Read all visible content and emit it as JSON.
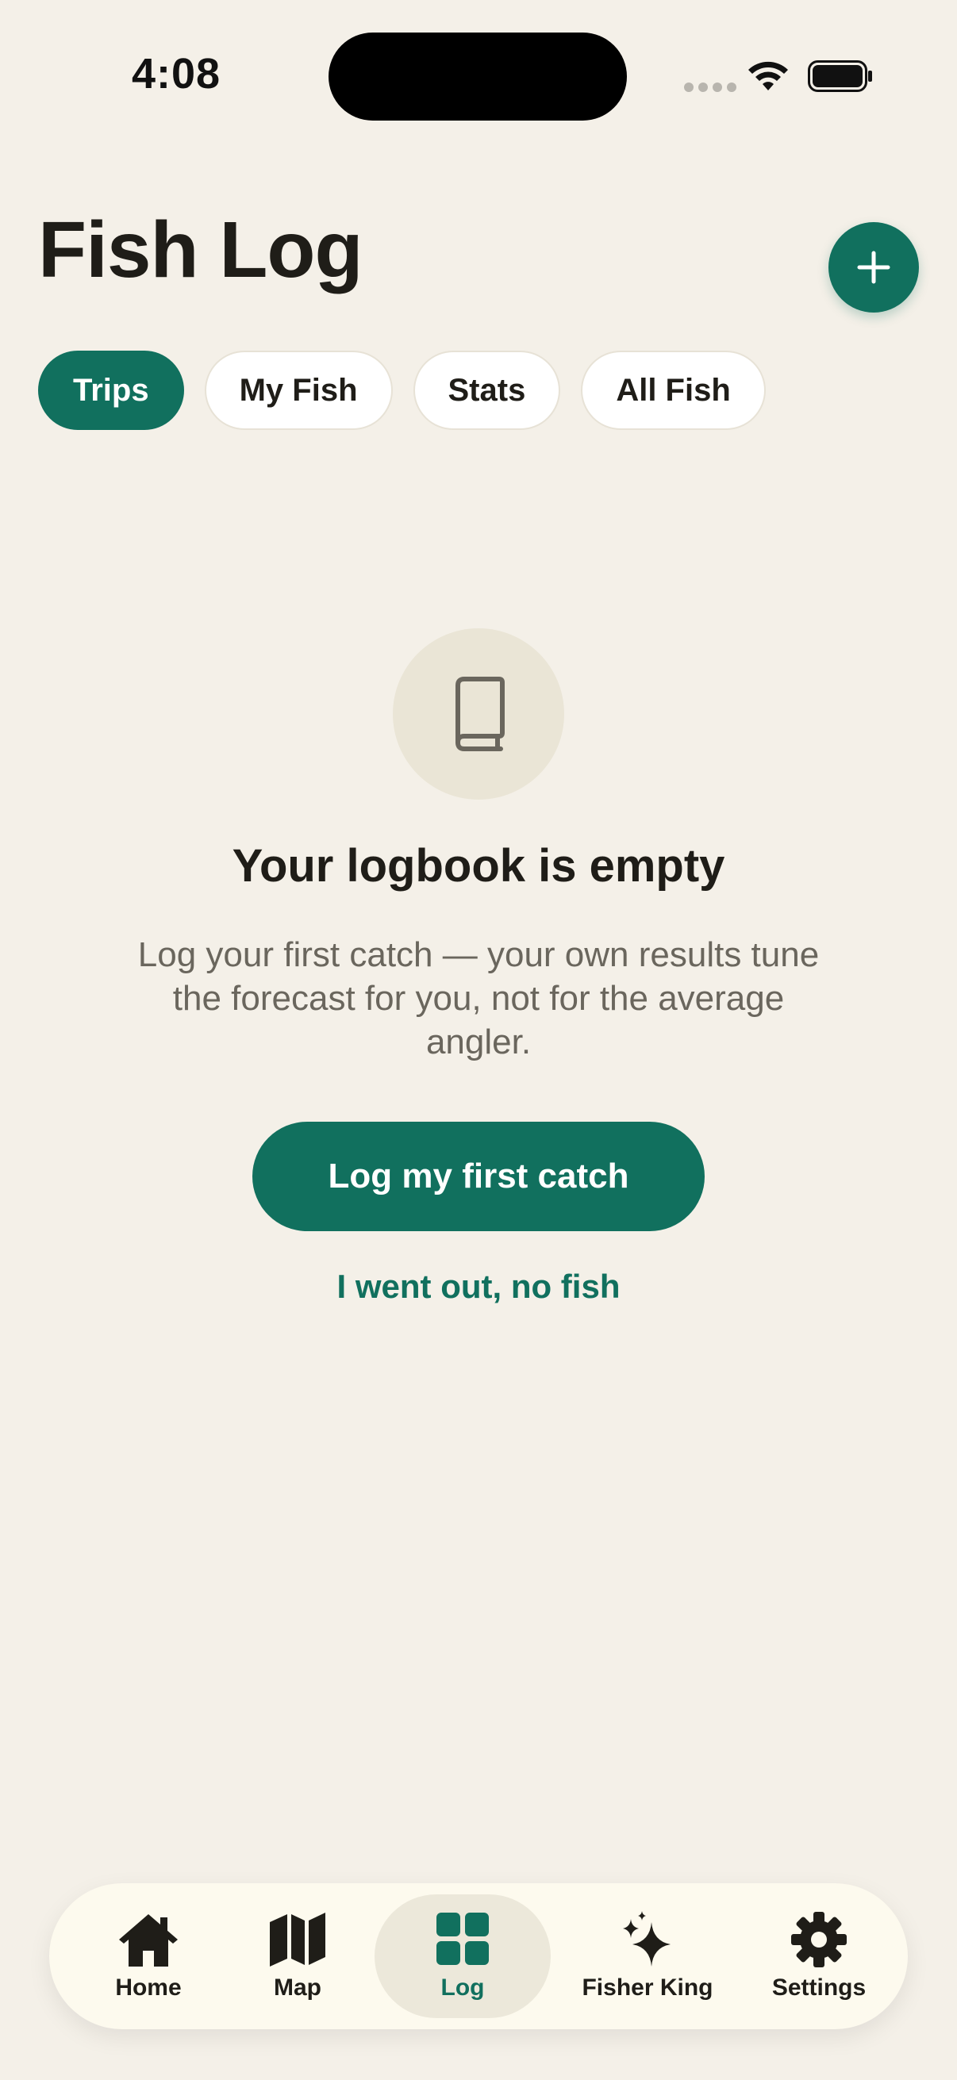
{
  "status_bar": {
    "time": "4:08"
  },
  "header": {
    "title": "Fish Log",
    "add_icon": "plus-icon"
  },
  "tabs": [
    {
      "label": "Trips",
      "active": true
    },
    {
      "label": "My Fish",
      "active": false
    },
    {
      "label": "Stats",
      "active": false
    },
    {
      "label": "All Fish",
      "active": false
    }
  ],
  "empty_state": {
    "icon": "book-icon",
    "title": "Your logbook is empty",
    "description": "Log your first catch — your own results tune the forecast for you, not for the average angler.",
    "primary_label": "Log my first catch",
    "secondary_label": "I went out, no fish"
  },
  "tabbar": {
    "items": [
      {
        "label": "Home",
        "icon": "home-icon",
        "active": false
      },
      {
        "label": "Map",
        "icon": "map-icon",
        "active": false
      },
      {
        "label": "Log",
        "icon": "grid-icon",
        "active": true
      },
      {
        "label": "Fisher King",
        "icon": "sparkles-icon",
        "active": false
      },
      {
        "label": "Settings",
        "icon": "gear-icon",
        "active": false
      }
    ]
  },
  "colors": {
    "background": "#F4F0E8",
    "accent": "#11705E",
    "text": "#1F1D18",
    "muted_text": "#6A665D",
    "tabbar_bg": "#FDFAEE"
  }
}
